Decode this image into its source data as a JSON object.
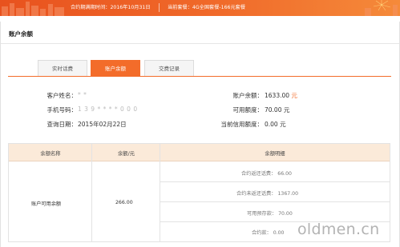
{
  "banner": {
    "contract_expiry": "合约期满期时间：2016年10月31日",
    "current_plan": "当前套餐：4G全国套餐-166元套餐",
    "colors": {
      "start": "#e8521e",
      "end": "#f58a3a"
    }
  },
  "panel": {
    "title": "账户余额"
  },
  "tabs": [
    {
      "label": "实时话费",
      "active": false
    },
    {
      "label": "账户余额",
      "active": true
    },
    {
      "label": "交费记录",
      "active": false
    }
  ],
  "info": {
    "customer_name_label": "客户姓名：",
    "customer_name_value": "*  *",
    "phone_label": "手机号码：",
    "phone_value": "1 3 9 * * * * 0 0 0",
    "query_date_label": "查询日期：",
    "query_date_value": "2015年02月22日",
    "balance_label": "账户余额：",
    "balance_value": "1633.00",
    "balance_unit": "元",
    "available_label": "可用额度：",
    "available_value": "70.00 元",
    "credit_label": "当前信用额度：",
    "credit_value": "0.00 元"
  },
  "table": {
    "headers": [
      "余额名称",
      "余额/元",
      "余额明细"
    ],
    "row": {
      "name": "账户可用余额",
      "amount": "266.00",
      "details": [
        "合约返还话费：  66.00",
        "合约未返还话费：  1367.00",
        "可用预存款：  70.00",
        "合约款：  0.00"
      ]
    }
  },
  "watermark": "oldmen.cn",
  "accent_color": "#f36c2a"
}
